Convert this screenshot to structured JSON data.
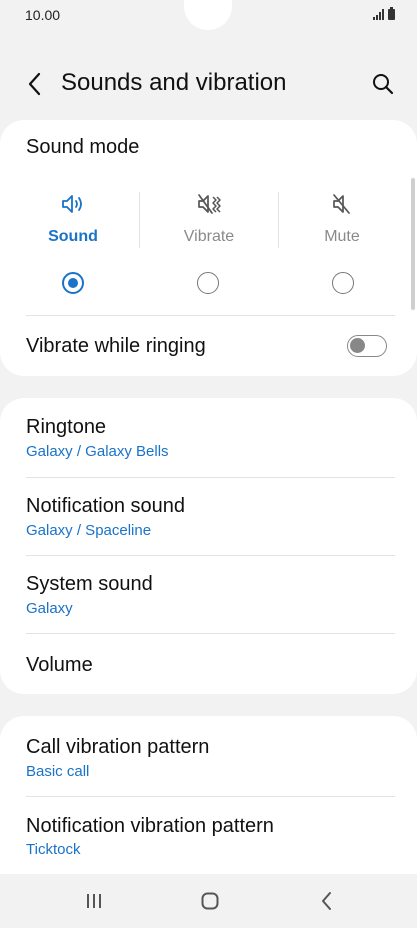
{
  "status_bar": {
    "time": "10.00"
  },
  "header": {
    "title": "Sounds and vibration",
    "back_icon": "back-arrow-icon",
    "search_icon": "search-icon"
  },
  "sound_mode": {
    "label": "Sound mode",
    "options": [
      {
        "label": "Sound",
        "icon": "speaker-icon",
        "selected": true
      },
      {
        "label": "Vibrate",
        "icon": "vibrate-icon",
        "selected": false
      },
      {
        "label": "Mute",
        "icon": "mute-icon",
        "selected": false
      }
    ],
    "vibrate_while_ringing": {
      "label": "Vibrate while ringing",
      "enabled": false
    }
  },
  "sound_settings": [
    {
      "title": "Ringtone",
      "value": "Galaxy / Galaxy Bells"
    },
    {
      "title": "Notification sound",
      "value": "Galaxy / Spaceline"
    },
    {
      "title": "System sound",
      "value": "Galaxy"
    },
    {
      "title": "Volume",
      "value": ""
    }
  ],
  "vibration_settings": [
    {
      "title": "Call vibration pattern",
      "value": "Basic call"
    },
    {
      "title": "Notification vibration pattern",
      "value": "Ticktock"
    }
  ],
  "colors": {
    "accent": "#1a73c8",
    "background": "#f2f2f2",
    "card": "#ffffff"
  }
}
